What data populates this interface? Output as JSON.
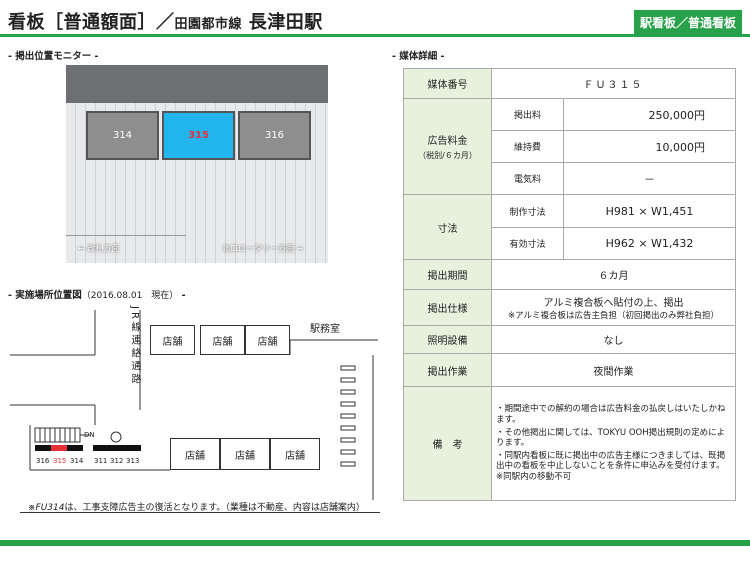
{
  "header": {
    "title_main": "看板［普通額面］／",
    "title_line": "田園都市線",
    "title_station": "長津田駅",
    "badge": "駅看板／普通看板"
  },
  "sections": {
    "monitor": "- 掲出位置モニター -",
    "map": "- 実施場所位置図",
    "map_date": "（2016.08.01　現在）",
    "map_end": "-",
    "details": "- 媒体詳細 -"
  },
  "photo": {
    "boards": [
      "314",
      "315",
      "316"
    ],
    "left_caption": "← 改札方面",
    "right_caption": "北口ロータリー方面 →"
  },
  "map": {
    "jr_passage": "JR線連絡通路",
    "office": "駅務室",
    "shop": "店舗",
    "dn": "DN",
    "nums_left": [
      "316",
      "315",
      "314"
    ],
    "nums_right": [
      "311",
      "312",
      "313"
    ],
    "note_italic": "※FU314",
    "note_rest": "は、工事支障広告主の復活となります。（業種は不動産、内容は店舗案内）"
  },
  "details": {
    "media_no_label": "媒体番号",
    "media_no": "ＦＵ３１５",
    "fee_label": "広告料金",
    "fee_sub": "（税別/６カ月）",
    "fee_rows": [
      {
        "label": "掲出料",
        "value": "250,000円"
      },
      {
        "label": "維持費",
        "value": "10,000円"
      },
      {
        "label": "電気料",
        "value": "－"
      }
    ],
    "size_label": "寸法",
    "size_rows": [
      {
        "label": "制作寸法",
        "value": "H981 × W1,451"
      },
      {
        "label": "有効寸法",
        "value": "H962 × W1,432"
      }
    ],
    "period_label": "掲出期間",
    "period": "６カ月",
    "spec_label": "掲出仕様",
    "spec_1": "アルミ複合板へ貼付の上、掲出",
    "spec_2": "※アルミ複合板は広告主負担（初回掲出のみ弊社負担）",
    "light_label": "照明設備",
    "light": "なし",
    "work_label": "掲出作業",
    "work": "夜間作業",
    "remarks_label": "備　考",
    "remarks": [
      "・期間途中での解約の場合は広告料金の払戻しはいたしかねます。",
      "・その他掲出に関しては、TOKYU OOH掲出規則の定めによります。",
      "・同駅内看板に既に掲出中の広告主様につきましては、既掲出中の看板を中止しないことを条件に申込みを受付けます。※同駅内の移動不可"
    ]
  },
  "colors": {
    "brand": "#27a14a",
    "header_cell": "#e8f1dd",
    "highlight": "#22b5ee",
    "accent_red": "#e8303b"
  }
}
